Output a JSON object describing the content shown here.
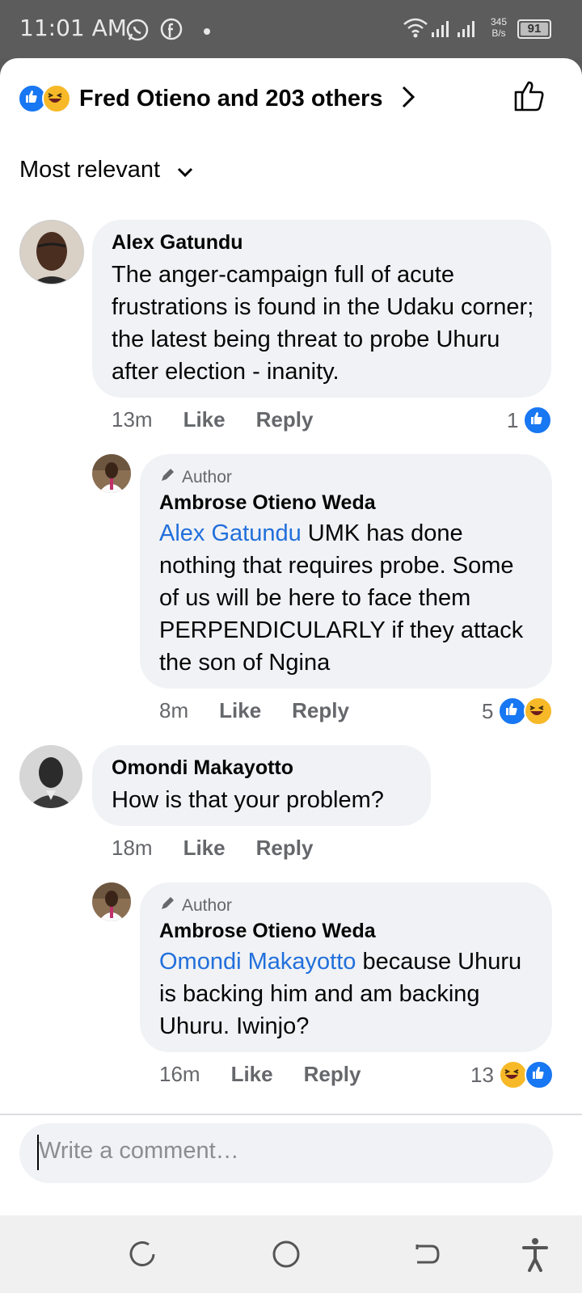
{
  "status_bar": {
    "time": "11:01 AM",
    "net_speed_value": "345",
    "net_speed_unit": "B/s",
    "battery": "91"
  },
  "reactions_header": {
    "label": "Fred Otieno and 203 others"
  },
  "sort": {
    "label": "Most relevant"
  },
  "comments": [
    {
      "name": "Alex Gatundu",
      "text": "The anger-campaign full of acute frustrations is found in the Udaku corner; the latest being threat to probe Uhuru after election - inanity.",
      "time": "13m",
      "like": "Like",
      "reply": "Reply",
      "reaction_count": "1"
    },
    {
      "author_label": "Author",
      "name": "Ambrose Otieno Weda",
      "mention": "Alex Gatundu",
      "text": " UMK has done nothing that requires probe. Some of us will be here to face them PERPENDICULARLY if they attack the son of Ngina",
      "time": "8m",
      "like": "Like",
      "reply": "Reply",
      "reaction_count": "5"
    },
    {
      "name": "Omondi Makayotto",
      "text": "How is that your problem?",
      "time": "18m",
      "like": "Like",
      "reply": "Reply"
    },
    {
      "author_label": "Author",
      "name": "Ambrose Otieno Weda",
      "mention": "Omondi Makayotto",
      "text": " because Uhuru is backing him and am backing Uhuru. Iwinjo?",
      "time": "16m",
      "like": "Like",
      "reply": "Reply",
      "reaction_count": "13"
    }
  ],
  "composer": {
    "placeholder": "Write a comment…"
  },
  "colors": {
    "brand_blue": "#1877f2",
    "mention_blue": "#216fdb",
    "bubble_bg": "#f0f2f5",
    "haha_yellow": "#f7b928"
  }
}
